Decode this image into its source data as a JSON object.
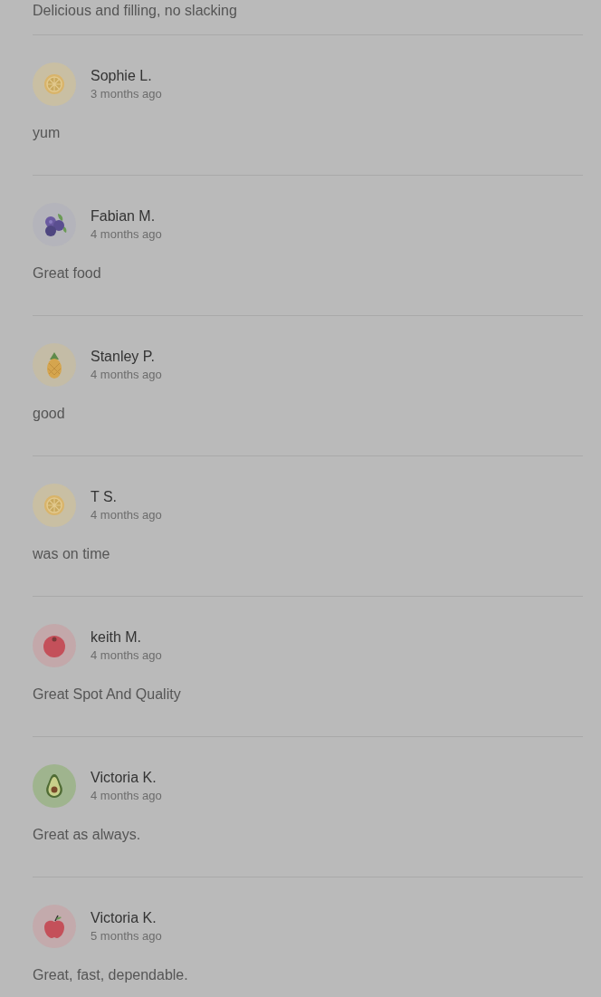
{
  "top_review_text": "Delicious and filling, no slacking",
  "reviews": [
    {
      "kind": "lemon",
      "name": "Sophie L.",
      "time": "3 months ago",
      "text": "yum"
    },
    {
      "kind": "blueberry",
      "name": "Fabian M.",
      "time": "4 months ago",
      "text": "Great food"
    },
    {
      "kind": "pineapple",
      "name": "Stanley P.",
      "time": "4 months ago",
      "text": "good"
    },
    {
      "kind": "lemon",
      "name": "T S.",
      "time": "4 months ago",
      "text": "was on time"
    },
    {
      "kind": "tomato",
      "name": "keith M.",
      "time": "4 months ago",
      "text": "Great Spot And Quality"
    },
    {
      "kind": "avocado",
      "name": "Victoria K.",
      "time": "4 months ago",
      "text": "Great as always."
    },
    {
      "kind": "apple",
      "name": "Victoria K.",
      "time": "5 months ago",
      "text": "Great, fast, dependable."
    }
  ]
}
